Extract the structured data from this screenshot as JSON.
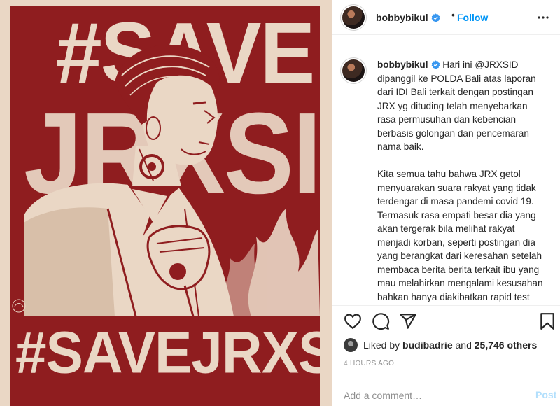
{
  "colors": {
    "poster_red": "#8f1d1f",
    "poster_cream": "#ead7c5",
    "link_blue": "#0095f6",
    "post_disabled": "#b2dffc",
    "muted_gray": "#8e8e8e"
  },
  "poster": {
    "headline_top": "#SAVE",
    "headline_middle": "JRXSID",
    "headline_bottom": "#SAVEJRXSID"
  },
  "header": {
    "username": "bobbybikul",
    "verified_icon": "verified-badge-icon",
    "separator": "•",
    "follow_label": "Follow",
    "more_icon": "more-options-icon"
  },
  "caption": {
    "username": "bobbybikul",
    "paragraph_1": "Hari ini @JRXSID dipanggil ke POLDA Bali atas laporan dari IDI Bali terkait dengan postingan JRX yg dituding telah menyebarkan rasa permusuhan dan kebencian berbasis golongan dan pencemaran nama baik.",
    "paragraph_2": "Kita semua tahu bahwa JRX getol menyuarakan suara rakyat yang tidak terdengar di masa pandemi covid 19. Termasuk rasa empati besar dia yang akan tergerak bila melihat rakyat menjadi korban, seperti postingan dia yang berangkat dari keresahan setelah membaca berita berita terkait ibu yang mau melahirkan mengalami kesusahan bahkan hanya diakibatkan rapid test yang dijadikan layanan"
  },
  "actions": {
    "like_icon": "heart-icon",
    "comment_icon": "comment-icon",
    "share_icon": "share-icon",
    "save_icon": "bookmark-icon"
  },
  "likes": {
    "prefix": "Liked by",
    "user": "budibadrie",
    "middle": "and",
    "count": "25,746 others"
  },
  "timestamp": "4 HOURS AGO",
  "comment": {
    "placeholder": "Add a comment…",
    "post_label": "Post"
  }
}
